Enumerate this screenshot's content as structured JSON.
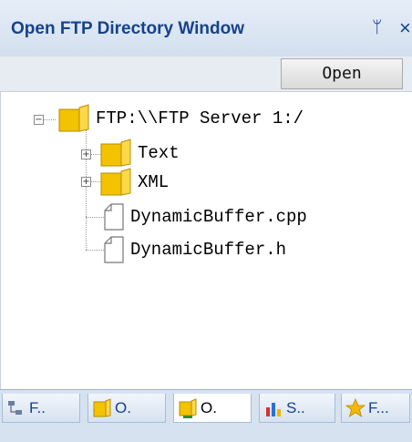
{
  "window": {
    "title": "Open FTP Directory Window",
    "pin_glyph": "ᛘ",
    "close_glyph": "×"
  },
  "toolbar": {
    "open_label": "Open"
  },
  "tree": {
    "root": {
      "label": "FTP:\\\\FTP Server 1:/",
      "expanded": true,
      "icon": "folder-icon"
    },
    "children": [
      {
        "label": "Text",
        "icon": "folder-icon",
        "expandable": true
      },
      {
        "label": "XML",
        "icon": "folder-icon",
        "expandable": true
      },
      {
        "label": "DynamicBuffer.cpp",
        "icon": "file-icon",
        "expandable": false
      },
      {
        "label": "DynamicBuffer.h",
        "icon": "file-icon",
        "expandable": false
      }
    ]
  },
  "tabs": [
    {
      "label": "F..",
      "icon": "tree-view-icon",
      "active": false
    },
    {
      "label": "O.",
      "icon": "folder-icon",
      "active": false
    },
    {
      "label": "O.",
      "icon": "ftp-folder-icon",
      "active": true
    },
    {
      "label": "S..",
      "icon": "chart-icon",
      "active": false
    },
    {
      "label": "F...",
      "icon": "star-icon",
      "active": false
    }
  ],
  "colors": {
    "title_text": "#15428b",
    "folder_yellow": "#f5c400"
  }
}
